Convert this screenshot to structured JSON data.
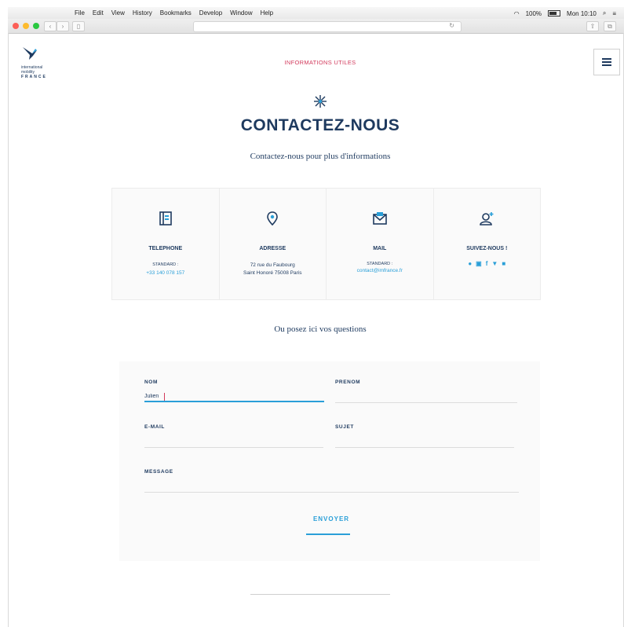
{
  "menubar": {
    "menus": [
      "File",
      "Edit",
      "View",
      "History",
      "Bookmarks",
      "Develop",
      "Window",
      "Help"
    ],
    "battery": "100%",
    "clock": "Mon 10:10"
  },
  "colors": {
    "navy": "#1e3a5f",
    "accent_red": "#d23a5c",
    "accent_blue": "#2a9fd8"
  },
  "logo": {
    "line1": "international",
    "line2": "mobility",
    "line3": "FRANCE"
  },
  "header": {
    "top_link": "INFORMATIONS UTILES",
    "menu_icon": "hamburger-icon"
  },
  "page": {
    "title": "CONTACTEZ-NOUS",
    "subtitle": "Contactez-nous pour plus d'informations",
    "questions_title": "Ou posez ici vos questions"
  },
  "contact": {
    "phone": {
      "icon": "phone-book-icon",
      "title": "TELEPHONE",
      "label": "STANDARD :",
      "value": "+33 140 078 157"
    },
    "address": {
      "icon": "location-pin-icon",
      "title": "ADRESSE",
      "line1": "72 rue du Faubourg",
      "line2": "Saint Honoré 75008 Paris"
    },
    "mail": {
      "icon": "envelope-icon",
      "title": "MAIL",
      "label": "STANDARD :",
      "value": "contact@imfrance.fr"
    },
    "social": {
      "icon": "user-plus-icon",
      "title": "SUIVEZ-NOUS !",
      "networks": [
        "wechat",
        "linkedin",
        "facebook",
        "twitter",
        "instagram"
      ]
    }
  },
  "form": {
    "nom_label": "NOM",
    "nom_value": "Julien",
    "prenom_label": "PRENOM",
    "email_label": "E-MAIL",
    "sujet_label": "SUJET",
    "message_label": "MESSAGE",
    "submit_label": "ENVOYER"
  }
}
